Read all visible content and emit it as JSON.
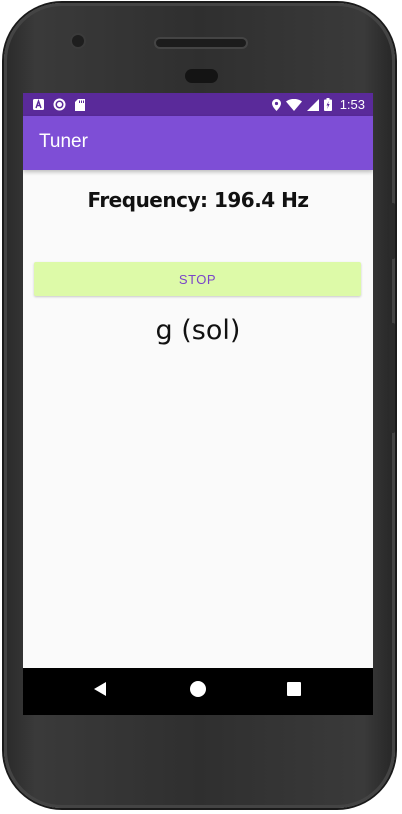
{
  "status_bar": {
    "time": "1:53",
    "left_icons": [
      "a-badge-icon",
      "circle-icon",
      "sd-card-icon"
    ],
    "right_icons": [
      "location-icon",
      "wifi-icon",
      "signal-icon",
      "battery-charging-icon"
    ]
  },
  "app_bar": {
    "title": "Tuner"
  },
  "main": {
    "frequency_text": "Frequency: 196.4 Hz",
    "stop_label": "STOP",
    "note_text": "g (sol)"
  },
  "nav_bar": {
    "back_icon": "back-triangle-icon",
    "home_icon": "home-circle-icon",
    "recents_icon": "recents-square-icon"
  },
  "colors": {
    "status_bar": "#5a2a9a",
    "app_bar": "#7e4ed6",
    "button_bg": "#ddfaa8",
    "button_text": "#7a45c9",
    "screen_bg": "#fafafa"
  }
}
